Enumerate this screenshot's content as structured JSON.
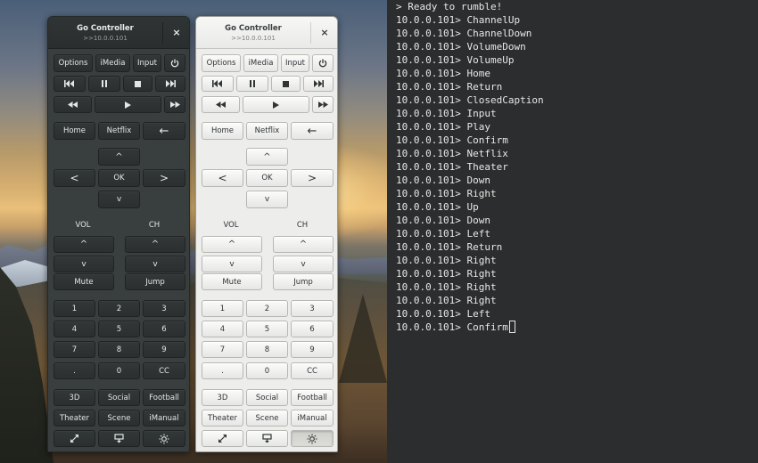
{
  "controller": {
    "title": "Go Controller",
    "address": ">>10.0.0.101",
    "close_glyph": "×",
    "buttons": {
      "options": "Options",
      "imedia": "iMedia",
      "input": "Input",
      "power_icon": "power-icon",
      "home": "Home",
      "netflix": "Netflix",
      "back_glyph": "←",
      "up_glyph": "^",
      "down_glyph": "v",
      "left_glyph": "<",
      "right_glyph": ">",
      "ok": "OK",
      "vol": "VOL",
      "ch": "CH",
      "mute": "Mute",
      "jump": "Jump",
      "d1": "1",
      "d2": "2",
      "d3": "3",
      "d4": "4",
      "d5": "5",
      "d6": "6",
      "d7": "7",
      "d8": "8",
      "d9": "9",
      "dot": ".",
      "d0": "0",
      "cc": "CC",
      "three_d": "3D",
      "social": "Social",
      "football": "Football",
      "theater": "Theater",
      "scene": "Scene",
      "imanual": "iManual"
    },
    "icons": [
      "skip-previous-icon",
      "pause-icon",
      "stop-icon",
      "skip-next-icon",
      "rewind-icon",
      "play-icon",
      "fast-forward-icon",
      "fullscreen-icon",
      "screen-icon",
      "brightness-icon"
    ]
  },
  "terminal": {
    "lines": [
      "> Ready to rumble!",
      "10.0.0.101> ChannelUp",
      "10.0.0.101> ChannelDown",
      "10.0.0.101> VolumeDown",
      "10.0.0.101> VolumeUp",
      "10.0.0.101> Home",
      "10.0.0.101> Return",
      "10.0.0.101> ClosedCaption",
      "10.0.0.101> Input",
      "10.0.0.101> Play",
      "10.0.0.101> Confirm",
      "10.0.0.101> Netflix",
      "10.0.0.101> Theater",
      "10.0.0.101> Down",
      "10.0.0.101> Right",
      "10.0.0.101> Up",
      "10.0.0.101> Down",
      "10.0.0.101> Left",
      "10.0.0.101> Return",
      "10.0.0.101> Right",
      "10.0.0.101> Right",
      "10.0.0.101> Right",
      "10.0.0.101> Right",
      "10.0.0.101> Left",
      "10.0.0.101> Confirm"
    ]
  }
}
